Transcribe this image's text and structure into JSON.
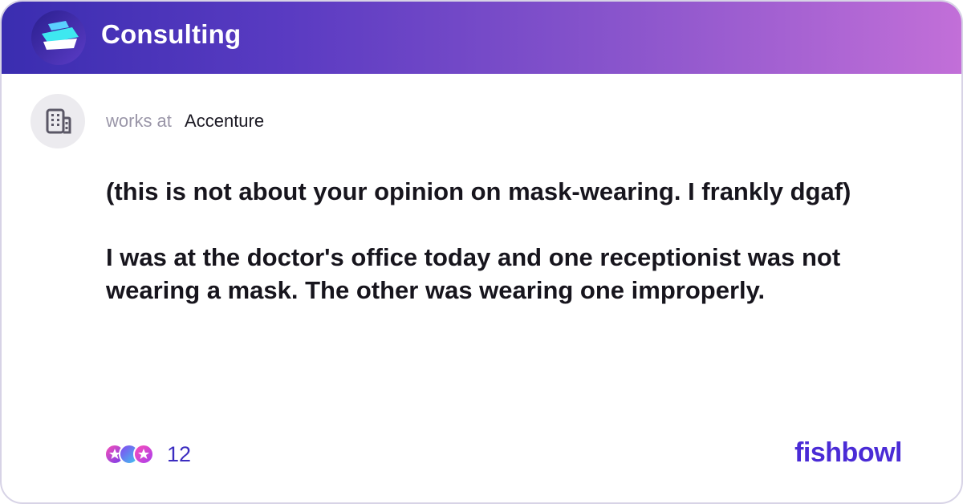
{
  "header": {
    "title": "Consulting",
    "gradient_start": "#3a2db0",
    "gradient_end": "#c26fd8"
  },
  "author": {
    "avatar_icon": "building-icon",
    "prefix": "works at",
    "company": "Accenture"
  },
  "post": {
    "lines": [
      "(this is not about your opinion on mask-wearing. I frankly dgaf)",
      "",
      "I was at the doctor's office today and one receptionist was not wearing a mask. The other was wearing one improperly."
    ]
  },
  "reactions": {
    "icons": [
      "star-reaction-icon",
      "moon-reaction-icon",
      "star-reaction-icon"
    ],
    "count": "12",
    "color": "#3b2cc0"
  },
  "brand": {
    "name": "fishbowl",
    "color": "#4a2bd6"
  }
}
